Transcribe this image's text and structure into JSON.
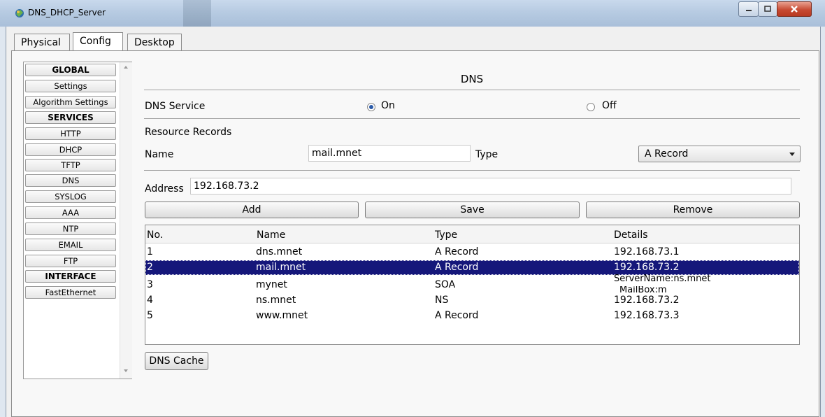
{
  "window": {
    "title": "DNS_DHCP_Server"
  },
  "tabs": [
    {
      "label": "Physical",
      "active": false
    },
    {
      "label": "Config",
      "active": true
    },
    {
      "label": "Desktop",
      "active": false
    }
  ],
  "sidebar": {
    "items": [
      {
        "label": "GLOBAL",
        "header": true
      },
      {
        "label": "Settings"
      },
      {
        "label": "Algorithm Settings"
      },
      {
        "label": "SERVICES",
        "header": true
      },
      {
        "label": "HTTP"
      },
      {
        "label": "DHCP"
      },
      {
        "label": "TFTP"
      },
      {
        "label": "DNS"
      },
      {
        "label": "SYSLOG"
      },
      {
        "label": "AAA"
      },
      {
        "label": "NTP"
      },
      {
        "label": "EMAIL"
      },
      {
        "label": "FTP"
      },
      {
        "label": "INTERFACE",
        "header": true
      },
      {
        "label": "FastEthernet"
      }
    ]
  },
  "dns": {
    "title": "DNS",
    "service_label": "DNS Service",
    "on_label": "On",
    "off_label": "Off",
    "service_state": "On",
    "resource_records_label": "Resource Records",
    "name_label": "Name",
    "name_value": "mail.mnet",
    "type_label": "Type",
    "type_value": "A Record",
    "address_label": "Address",
    "address_value": "192.168.73.2",
    "buttons": {
      "add": "Add",
      "save": "Save",
      "remove": "Remove"
    },
    "table": {
      "headers": [
        "No.",
        "Name",
        "Type",
        "Details"
      ],
      "rows": [
        {
          "no": "1",
          "name": "dns.mnet",
          "type": "A Record",
          "details": "192.168.73.1"
        },
        {
          "no": "2",
          "name": "mail.mnet",
          "type": "A Record",
          "details": "192.168.73.2",
          "selected": true
        },
        {
          "no": "3",
          "name": "mynet",
          "type": "SOA",
          "details": "ServerName:ns.mnet",
          "details2": "MailBox:m"
        },
        {
          "no": "4",
          "name": "ns.mnet",
          "type": "NS",
          "details": "192.168.73.2"
        },
        {
          "no": "5",
          "name": "www.mnet",
          "type": "A Record",
          "details": "192.168.73.3"
        }
      ]
    },
    "cache_button": "DNS Cache"
  },
  "colors": {
    "selection": "#15177a",
    "close_button": "#c74a33"
  }
}
